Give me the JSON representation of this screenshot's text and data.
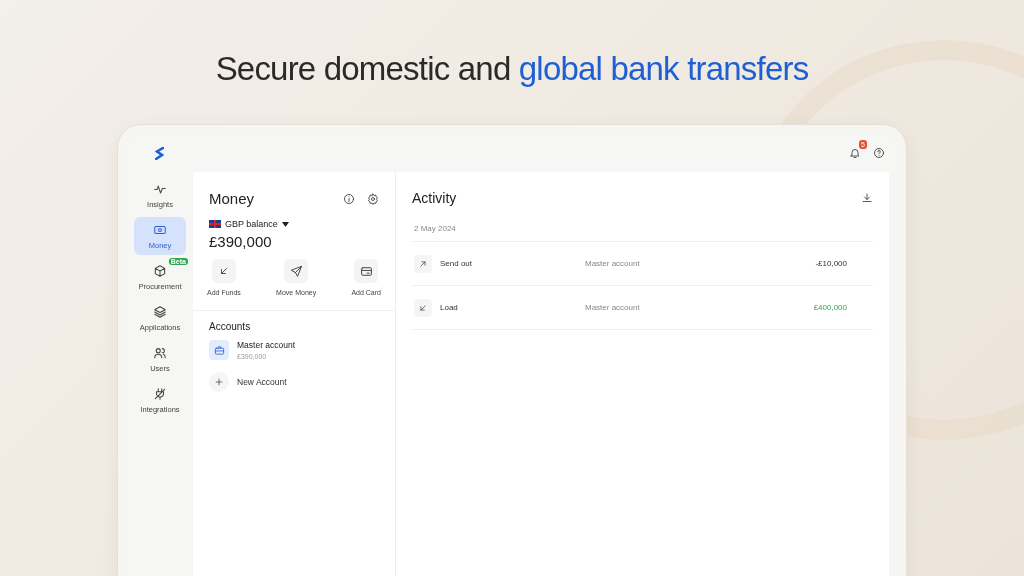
{
  "headline": {
    "text": "Secure domestic and",
    "highlight": "global bank transfers"
  },
  "topbar": {
    "notification_count": "5"
  },
  "sidebar": {
    "items": [
      {
        "label": "Insights",
        "selected": false
      },
      {
        "label": "Money",
        "selected": true
      },
      {
        "label": "Procurement",
        "selected": false,
        "badge": "Beta"
      },
      {
        "label": "Applications",
        "selected": false
      },
      {
        "label": "Users",
        "selected": false
      },
      {
        "label": "Integrations",
        "selected": false
      }
    ]
  },
  "money": {
    "title": "Money",
    "balance_label": "GBP balance",
    "balance": "£390,000",
    "actions": [
      {
        "label": "Add Funds"
      },
      {
        "label": "Move Money"
      },
      {
        "label": "Add Card"
      }
    ],
    "accounts_title": "Accounts",
    "accounts": [
      {
        "name": "Master account",
        "amount": "£390,000"
      }
    ],
    "new_account": "New Account"
  },
  "activity": {
    "title": "Activity",
    "date": "2 May 2024",
    "rows": [
      {
        "kind": "out",
        "label": "Send out",
        "account": "Master account",
        "amount": "-£10,000"
      },
      {
        "kind": "in",
        "label": "Load",
        "account": "Master account",
        "amount": "£400,000"
      }
    ]
  }
}
